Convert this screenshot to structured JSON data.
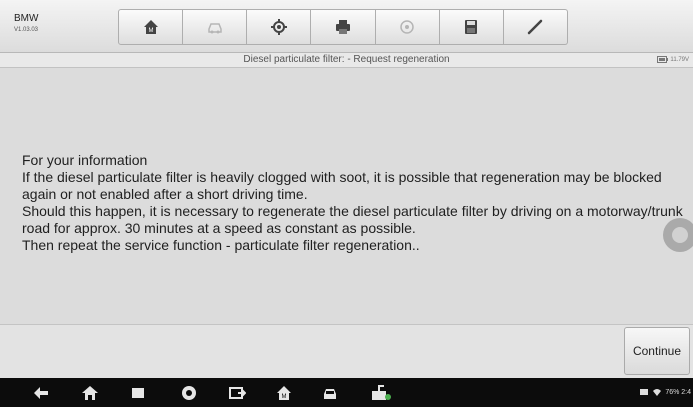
{
  "header": {
    "brand": "BMW",
    "version": "V1.03.03",
    "toolbar": [
      {
        "name": "home-icon"
      },
      {
        "name": "vehicle-swap-icon",
        "disabled": true
      },
      {
        "name": "settings-gear-icon"
      },
      {
        "name": "print-icon"
      },
      {
        "name": "help-icon",
        "disabled": true
      },
      {
        "name": "save-icon"
      },
      {
        "name": "pen-icon"
      }
    ]
  },
  "title_bar": {
    "title": "Diesel particulate filter: - Request regeneration",
    "battery_icon": "battery-icon",
    "battery_text": "11.79V"
  },
  "message": {
    "lines": [
      "For your information",
      "If the diesel particulate filter is heavily clogged with soot, it is possible that regeneration may be blocked again or not enabled after a short driving time.",
      "Should this happen, it is necessary to regenerate the diesel particulate filter by driving on a motorway/trunk road for approx. 30 minutes at a speed as constant as possible.",
      "Then repeat the service function - particulate filter regeneration.."
    ]
  },
  "footer": {
    "continue_label": "Continue"
  },
  "android_nav": {
    "items": [
      "back-icon",
      "home-icon",
      "recent-apps-icon",
      "browser-icon",
      "screenshot-icon",
      "maxisys-home-icon",
      "vehicle-icon",
      "vci-icon"
    ],
    "status_text": "76% 2:4",
    "status_icons": [
      "message-icon",
      "wifi-icon",
      "battery-icon"
    ]
  },
  "colors": {
    "background": "#d9d9d9",
    "nav_background": "#0c0c0c",
    "text": "#1f1f1f"
  }
}
